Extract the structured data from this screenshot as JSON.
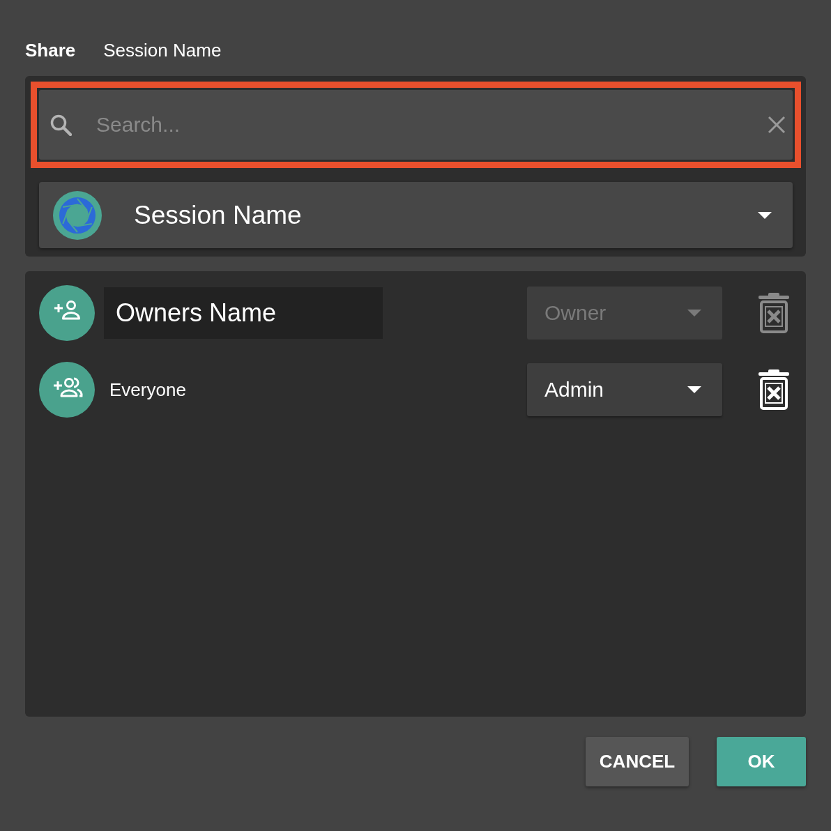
{
  "dialog": {
    "title": "Share",
    "subtitle": "Session Name"
  },
  "search": {
    "placeholder": "Search...",
    "highlighted": true
  },
  "session_select": {
    "value": "Session Name"
  },
  "members": [
    {
      "kind": "user",
      "name": "Owners Name",
      "role": "Owner",
      "disabled": true
    },
    {
      "kind": "group",
      "name": "Everyone",
      "role": "Admin",
      "disabled": false
    }
  ],
  "buttons": [
    {
      "label": "CANCEL",
      "kind": "secondary"
    },
    {
      "label": "OK",
      "kind": "primary"
    }
  ]
}
